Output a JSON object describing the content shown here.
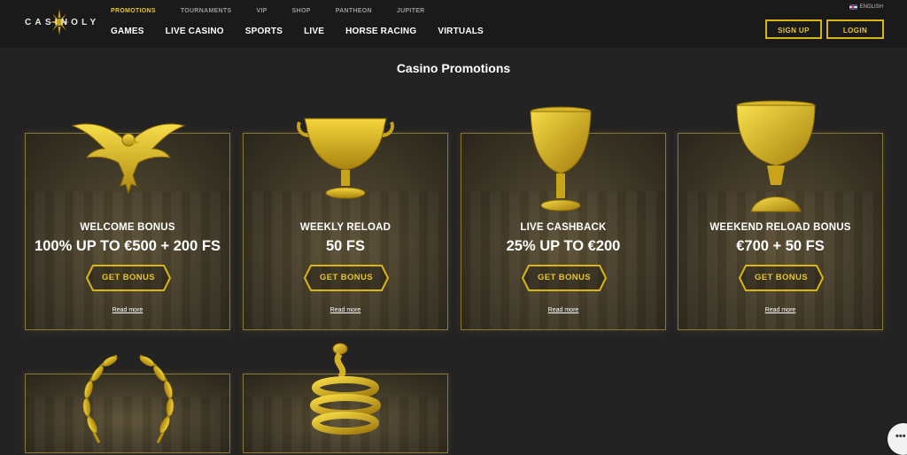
{
  "brand": {
    "logo_text": "CASINOLY"
  },
  "top_nav": [
    {
      "label": "PROMOTIONS",
      "active": true
    },
    {
      "label": "TOURNAMENTS",
      "active": false
    },
    {
      "label": "VIP",
      "active": false
    },
    {
      "label": "SHOP",
      "active": false
    },
    {
      "label": "PANTHEON",
      "active": false
    },
    {
      "label": "JUPITER",
      "active": false
    }
  ],
  "main_nav": [
    "GAMES",
    "LIVE CASINO",
    "SPORTS",
    "LIVE",
    "HORSE RACING",
    "VIRTUALS"
  ],
  "language": "ENGLISH",
  "auth": {
    "signup": "SIGN UP",
    "login": "LOGIN"
  },
  "page_title": "Casino Promotions",
  "cards": [
    {
      "title": "WELCOME BONUS",
      "offer": "100% UP TO €500 + 200 FS",
      "button": "GET BONUS",
      "more": "Read more",
      "icon": "eagle-icon"
    },
    {
      "title": "WEEKLY RELOAD",
      "offer": "50 FS",
      "button": "GET BONUS",
      "more": "Read more",
      "icon": "krater-vase-icon"
    },
    {
      "title": "LIVE CASHBACK",
      "offer": "25% UP TO €200",
      "button": "GET BONUS",
      "more": "Read more",
      "icon": "goblet-icon"
    },
    {
      "title": "WEEKEND RELOAD BONUS",
      "offer": "€700 + 50 FS",
      "button": "GET BONUS",
      "more": "Read more",
      "icon": "cup-icon"
    }
  ],
  "row2_icons": [
    "laurel-wreath-icon",
    "snake-bracelet-icon"
  ],
  "colors": {
    "accent": "#e7c52c",
    "background": "#242323",
    "header": "#1a1a1a"
  }
}
